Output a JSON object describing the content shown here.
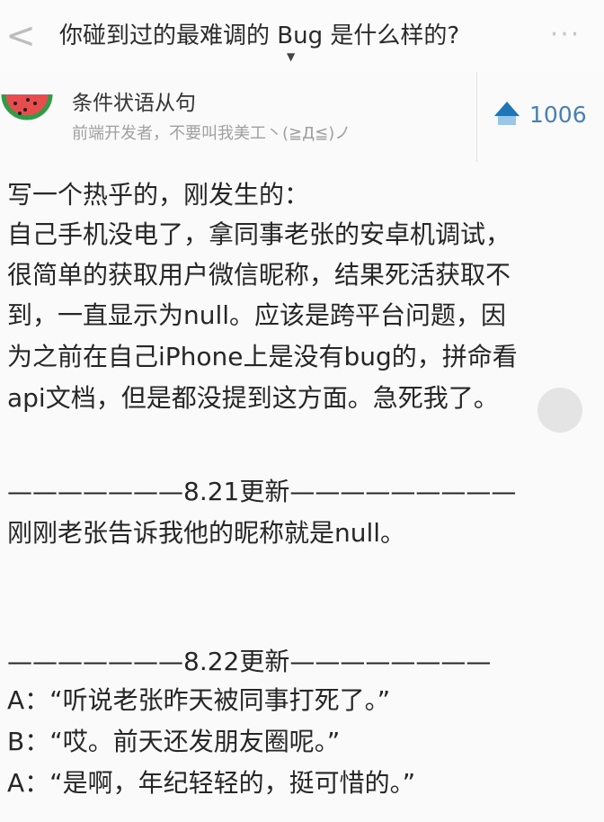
{
  "nav": {
    "back_glyph": "<",
    "title": "你碰到过的最难调的 Bug 是什么样的?",
    "caret": "▼",
    "more": "···"
  },
  "author": {
    "name": "条件状语从句",
    "bio": "前端开发者，不要叫我美工丶(≧Д≦)ノ",
    "avatar_icon": "watermelon-icon"
  },
  "vote": {
    "icon": "up-arrow-icon",
    "count": "1006"
  },
  "content": {
    "paragraph_lines": [
      "写一个热乎的，刚发生的：",
      "自己手机没电了，拿同事老张的安卓机调试，",
      "很简单的获取用户微信昵称，结果死活获取不",
      "到，一直显示为null。应该是跨平台问题，因",
      "为之前在自己iPhone上是没有bug的，拼命看",
      "api文档，但是都没提到这方面。急死我了。"
    ],
    "update1_divider": "———————8.21更新—————————",
    "update1_text": "刚刚老张告诉我他的昵称就是null。",
    "update2_divider": "———————8.22更新————————",
    "dialog": [
      "A：“听说老张昨天被同事打死了。”",
      "B：“哎。前天还发朋友圈呢。”",
      "A：“是啊，年纪轻轻的，挺可惜的。”"
    ]
  }
}
